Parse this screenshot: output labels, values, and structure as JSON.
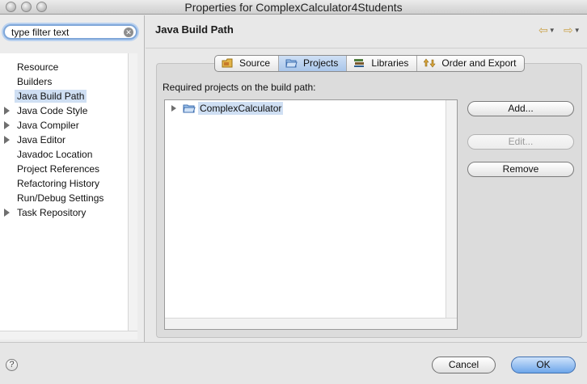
{
  "window": {
    "title": "Properties for ComplexCalculator4Students"
  },
  "filter": {
    "placeholder": "type filter text"
  },
  "sidebar": {
    "items": [
      {
        "label": "Resource",
        "expandable": false,
        "selected": false
      },
      {
        "label": "Builders",
        "expandable": false,
        "selected": false
      },
      {
        "label": "Java Build Path",
        "expandable": false,
        "selected": true
      },
      {
        "label": "Java Code Style",
        "expandable": true,
        "selected": false
      },
      {
        "label": "Java Compiler",
        "expandable": true,
        "selected": false
      },
      {
        "label": "Java Editor",
        "expandable": true,
        "selected": false
      },
      {
        "label": "Javadoc Location",
        "expandable": false,
        "selected": false
      },
      {
        "label": "Project References",
        "expandable": false,
        "selected": false
      },
      {
        "label": "Refactoring History",
        "expandable": false,
        "selected": false
      },
      {
        "label": "Run/Debug Settings",
        "expandable": false,
        "selected": false
      },
      {
        "label": "Task Repository",
        "expandable": true,
        "selected": false
      }
    ]
  },
  "page": {
    "title": "Java Build Path",
    "tabs": [
      {
        "label": "Source",
        "icon": "source-folder-icon"
      },
      {
        "label": "Projects",
        "icon": "projects-folder-icon",
        "active": true
      },
      {
        "label": "Libraries",
        "icon": "libraries-icon"
      },
      {
        "label": "Order and Export",
        "icon": "order-export-icon"
      }
    ],
    "required_label": "Required projects on the build path:",
    "projects": [
      {
        "label": "ComplexCalculator"
      }
    ],
    "buttons": {
      "add": "Add...",
      "edit": "Edit...",
      "remove": "Remove"
    }
  },
  "footer": {
    "cancel": "Cancel",
    "ok": "OK"
  },
  "colors": {
    "selection": "#cfdff3",
    "accent": "#6ea6ea"
  }
}
